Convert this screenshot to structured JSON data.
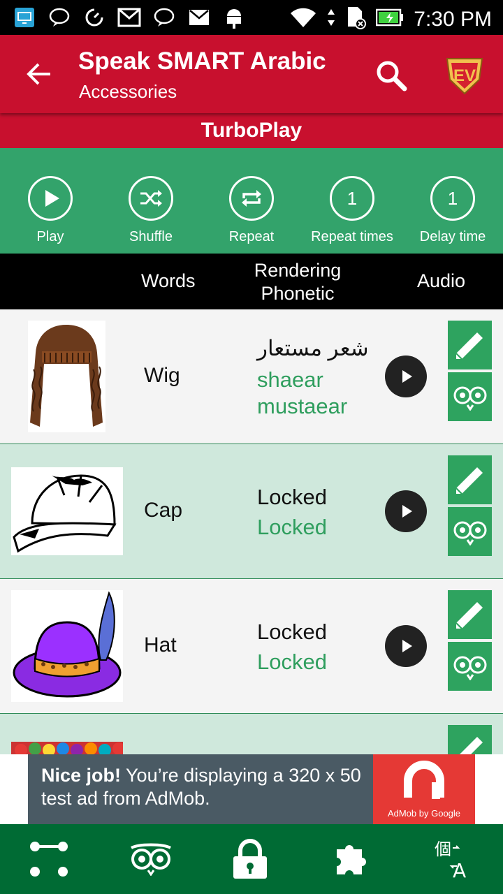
{
  "status_bar": {
    "time": "7:30 PM",
    "icons": [
      "screen-cast-icon",
      "chat-bubble-icon",
      "sync-icon",
      "gmail-icon",
      "chat-bubble-icon",
      "mail-icon",
      "android-icon",
      "wifi-icon",
      "data-arrows-icon",
      "sd-card-icon",
      "battery-charging-icon"
    ]
  },
  "app_bar": {
    "title": "Speak SMART Arabic",
    "subtitle": "Accessories",
    "logo_text": "EV"
  },
  "turbo_bar": {
    "label": "TurboPlay"
  },
  "controls": [
    {
      "id": "play",
      "label": "Play",
      "icon": "play-icon"
    },
    {
      "id": "shuffle",
      "label": "Shuffle",
      "icon": "shuffle-icon"
    },
    {
      "id": "repeat",
      "label": "Repeat",
      "icon": "repeat-icon"
    },
    {
      "id": "repeat_times",
      "label": "Repeat times",
      "value": "1"
    },
    {
      "id": "delay_time",
      "label": "Delay time",
      "value": "1"
    }
  ],
  "table_header": {
    "words": "Words",
    "rendering": "Rendering",
    "phonetic": "Phonetic",
    "audio": "Audio"
  },
  "rows": [
    {
      "word": "Wig",
      "rendering": "شعر مستعار",
      "phonetic": "shaear mustaear",
      "image": "wig"
    },
    {
      "word": "Cap",
      "rendering": "Locked",
      "phonetic": "Locked",
      "image": "cap"
    },
    {
      "word": "Hat",
      "rendering": "Locked",
      "phonetic": "Locked",
      "image": "hat"
    },
    {
      "word": "",
      "rendering": "",
      "phonetic": "",
      "image": "buttons"
    }
  ],
  "ad": {
    "headline": "Nice job!",
    "body": " You’re displaying a 320 x 50 test ad from AdMob.",
    "logo_caption": "AdMob by Google"
  },
  "bottom_nav": [
    "flow-icon",
    "owl-icon",
    "lock-icon",
    "puzzle-icon",
    "translate-icon"
  ],
  "colors": {
    "primary_red": "#c8102e",
    "control_green": "#33a36b",
    "row_green": "#cfe8dc",
    "button_green": "#2ea35f",
    "nav_green": "#006b34",
    "phonetic_green": "#2f9e5e"
  }
}
